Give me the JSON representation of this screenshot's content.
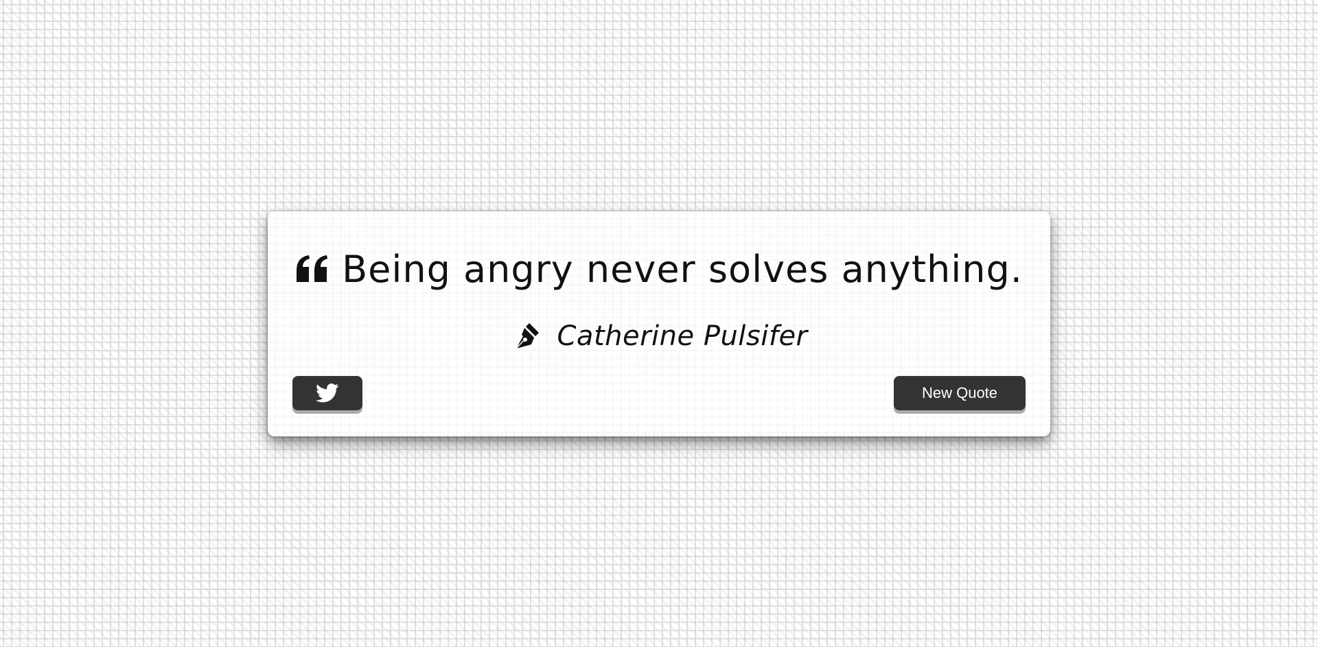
{
  "quote": {
    "icon": "quote-left-icon",
    "text": "Being angry never solves anything."
  },
  "author": {
    "icon": "pen-nib-icon",
    "name": "Catherine Pulsifer"
  },
  "actions": {
    "tweet_icon": "twitter-icon",
    "new_quote_label": "New Quote"
  },
  "colors": {
    "button_bg": "#333333",
    "text": "#111111"
  }
}
